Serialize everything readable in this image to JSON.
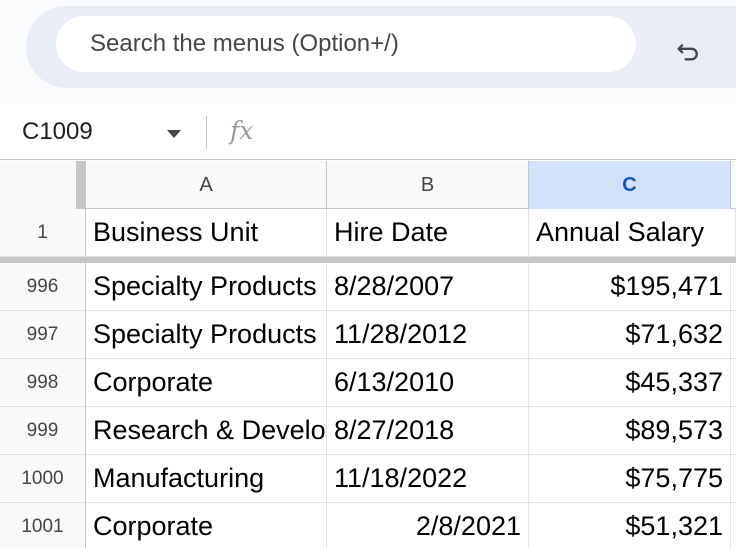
{
  "toolbar": {
    "search_placeholder": "Search the menus (Option+/)",
    "undo_icon": "undo-icon"
  },
  "formula_bar": {
    "name_box": "C1009",
    "fx_label": "fx",
    "formula": ""
  },
  "columns": [
    {
      "label": "A",
      "selected": false
    },
    {
      "label": "B",
      "selected": false
    },
    {
      "label": "C",
      "selected": true
    }
  ],
  "header_row": {
    "number": "1",
    "cells": [
      "Business Unit",
      "Hire Date",
      "Annual Salary"
    ]
  },
  "rows": [
    {
      "number": "996",
      "cells": [
        "Specialty Products",
        "8/28/2007",
        "$195,471"
      ]
    },
    {
      "number": "997",
      "cells": [
        "Specialty Products",
        "11/28/2012",
        "$71,632"
      ]
    },
    {
      "number": "998",
      "cells": [
        "Corporate",
        "6/13/2010",
        "$45,337"
      ]
    },
    {
      "number": "999",
      "cells": [
        "Research & Development",
        "8/27/2018",
        "$89,573"
      ]
    },
    {
      "number": "1000",
      "cells": [
        "Manufacturing",
        "11/18/2022",
        "$75,775"
      ]
    },
    {
      "number": "1001",
      "cells": [
        "Corporate",
        "2/8/2021",
        "$51,321"
      ]
    }
  ],
  "colors": {
    "selected_header_bg": "#d3e3fd",
    "selected_header_text": "#0b57d0",
    "header_bg": "#f8f9fa"
  }
}
